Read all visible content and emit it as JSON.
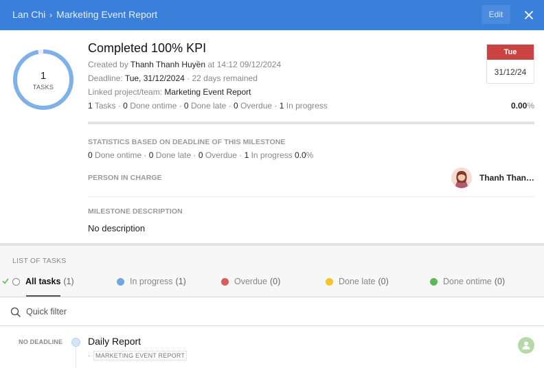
{
  "header": {
    "breadcrumb_parent": "Lan Chi",
    "breadcrumb_sep": "›",
    "breadcrumb_current": "Marketing Event Report",
    "edit_label": "Edit",
    "close_icon": "close-icon"
  },
  "summary": {
    "ring_count": "1",
    "ring_label": "TASKS",
    "ring_progress": 0.97,
    "title": "Completed 100% KPI",
    "created_prefix": "Created by",
    "created_by": "Thanh Thanh Huyền",
    "created_at": "at 14:12 09/12/2024",
    "deadline_prefix": "Deadline:",
    "deadline": "Tue, 31/12/2024",
    "deadline_remaining": "· 22 days remained",
    "linked_prefix": "Linked project/team:",
    "linked": "Marketing Event Report",
    "counts": {
      "tasks_n": "1",
      "tasks_label": "Tasks ·",
      "ontime_n": "0",
      "ontime_label": "Done ontime ·",
      "late_n": "0",
      "late_label": "Done late ·",
      "overdue_n": "0",
      "overdue_label": "Overdue ·",
      "inprogress_n": "1",
      "inprogress_label": "In progress"
    },
    "percent": "0.00",
    "percent_unit": "%",
    "progress": 0.0,
    "date_dow": "Tue",
    "date_value": "31/12/24"
  },
  "milestone_stats": {
    "title": "STATISTICS BASED ON DEADLINE OF THIS MILESTONE",
    "ontime_n": "0",
    "ontime_label": "Done ontime ·",
    "late_n": "0",
    "late_label": "Done late ·",
    "overdue_n": "0",
    "overdue_label": "Overdue ·",
    "inprogress_n": "1",
    "inprogress_label": "In progress",
    "pct": "0.0",
    "pct_unit": "%"
  },
  "person": {
    "label": "PERSON IN CHARGE",
    "name": "Thanh Thanh Huyền"
  },
  "description": {
    "label": "MILESTONE DESCRIPTION",
    "text": "No description"
  },
  "task_list": {
    "title": "LIST OF TASKS",
    "filters": [
      {
        "label": "All tasks",
        "count": "(1)",
        "color": "#ffffff"
      },
      {
        "label": "In progress",
        "count": "(1)",
        "color": "#6fa8dc"
      },
      {
        "label": "Overdue",
        "count": "(0)",
        "color": "#d45f5f"
      },
      {
        "label": "Done late",
        "count": "(0)",
        "color": "#f4c430"
      },
      {
        "label": "Done ontime",
        "count": "(0)",
        "color": "#5cb85c"
      }
    ],
    "quick_filter_placeholder": "Quick filter",
    "rows": [
      {
        "deadline": "NO DEADLINE",
        "title": "Daily Report",
        "tag_prefix": "·",
        "tag": "MARKETING EVENT REPORT"
      }
    ]
  },
  "colors": {
    "header_bg": "#3a7fd9",
    "ring": "#7fb1e8",
    "date_badge": "#c94343"
  }
}
